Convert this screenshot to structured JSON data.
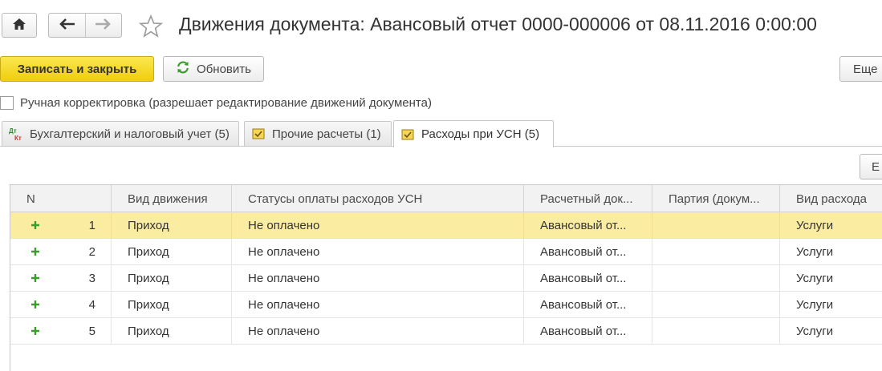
{
  "window": {
    "title": "Движения документа: Авансовый отчет 0000-000006 от 08.11.2016 0:00:00"
  },
  "nav": {
    "home_icon": "home-icon",
    "back_icon": "arrow-left-icon",
    "forward_icon": "arrow-right-icon",
    "favorite_icon": "star-icon"
  },
  "toolbar": {
    "save_close_label": "Записать и закрыть",
    "refresh_label": "Обновить",
    "more_label": "Еще"
  },
  "manual_edit": {
    "checked": false,
    "label": "Ручная корректировка (разрешает редактирование движений документа)"
  },
  "tabs": [
    {
      "label": "Бухгалтерский и налоговый учет (5)",
      "icon": "dt-kt-icon",
      "active": false
    },
    {
      "label": "Прочие расчеты (1)",
      "icon": "register-icon",
      "active": false
    },
    {
      "label": "Расходы при УСН (5)",
      "icon": "register-icon",
      "active": true
    }
  ],
  "grid_toolbar": {
    "button_label": "Е"
  },
  "table": {
    "columns": [
      "N",
      "Вид движения",
      "Статусы оплаты расходов УСН",
      "Расчетный док...",
      "Партия (докум...",
      "Вид расхода"
    ],
    "rows": [
      {
        "n": "1",
        "movement": "Приход",
        "status": "Не оплачено",
        "doc": "Авансовый от...",
        "batch": "",
        "expense": "Услуги",
        "selected": true
      },
      {
        "n": "2",
        "movement": "Приход",
        "status": "Не оплачено",
        "doc": "Авансовый от...",
        "batch": "",
        "expense": "Услуги",
        "selected": false
      },
      {
        "n": "3",
        "movement": "Приход",
        "status": "Не оплачено",
        "doc": "Авансовый от...",
        "batch": "",
        "expense": "Услуги",
        "selected": false
      },
      {
        "n": "4",
        "movement": "Приход",
        "status": "Не оплачено",
        "doc": "Авансовый от...",
        "batch": "",
        "expense": "Услуги",
        "selected": false
      },
      {
        "n": "5",
        "movement": "Приход",
        "status": "Не оплачено",
        "doc": "Авансовый от...",
        "batch": "",
        "expense": "Услуги",
        "selected": false
      }
    ]
  },
  "colors": {
    "primary_button": "#f5d92a",
    "selected_row": "#faeca0",
    "plus_icon": "#3c9a2e"
  }
}
